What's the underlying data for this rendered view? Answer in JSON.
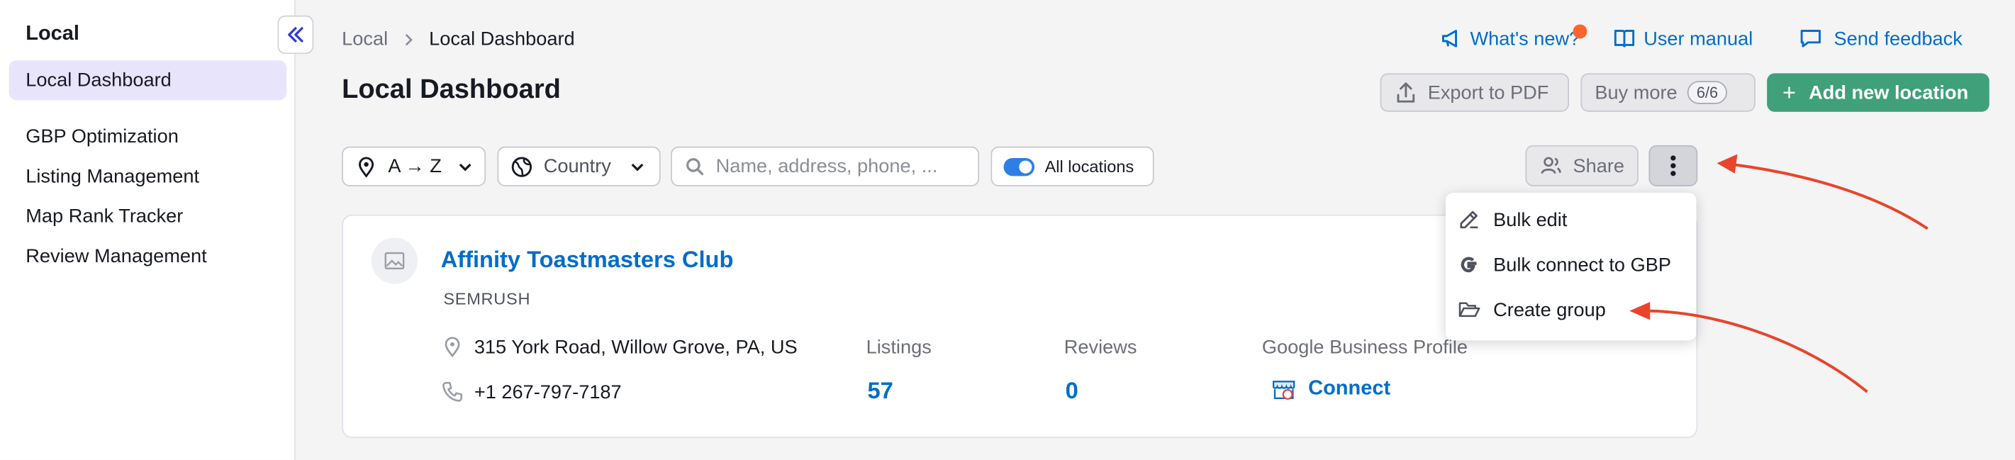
{
  "sidebar": {
    "title": "Local",
    "items": [
      {
        "label": "Local Dashboard"
      },
      {
        "label": "GBP Optimization"
      },
      {
        "label": "Listing Management"
      },
      {
        "label": "Map Rank Tracker"
      },
      {
        "label": "Review Management"
      }
    ]
  },
  "breadcrumb": {
    "parent": "Local",
    "current": "Local Dashboard"
  },
  "header": {
    "title": "Local Dashboard",
    "whats_new": "What's new?",
    "user_manual": "User manual",
    "send_feedback": "Send feedback",
    "export_pdf": "Export to PDF",
    "buy_more": "Buy more",
    "buy_more_count": "6/6",
    "add_location": "Add new location"
  },
  "filters": {
    "sort": "A → Z",
    "country": "Country",
    "search_placeholder": "Name, address, phone, ...",
    "all_locations": "All locations",
    "share": "Share"
  },
  "menu": {
    "items": [
      {
        "label": "Bulk edit"
      },
      {
        "label": "Bulk connect to GBP"
      },
      {
        "label": "Create group"
      }
    ]
  },
  "location": {
    "name": "Affinity Toastmasters Club",
    "subtitle": "SEMRUSH",
    "address": "315 York Road, Willow Grove, PA, US",
    "phone": "+1 267-797-7187",
    "listings_label": "Listings",
    "listings_value": "57",
    "reviews_label": "Reviews",
    "reviews_value": "0",
    "gbp_label": "Google Business Profile",
    "gbp_connect": "Connect"
  },
  "colors": {
    "accent_blue": "#006dca",
    "brand_green": "#3fa07a",
    "annotation_red": "#e8452c",
    "active_bg": "#e7e4fb"
  }
}
